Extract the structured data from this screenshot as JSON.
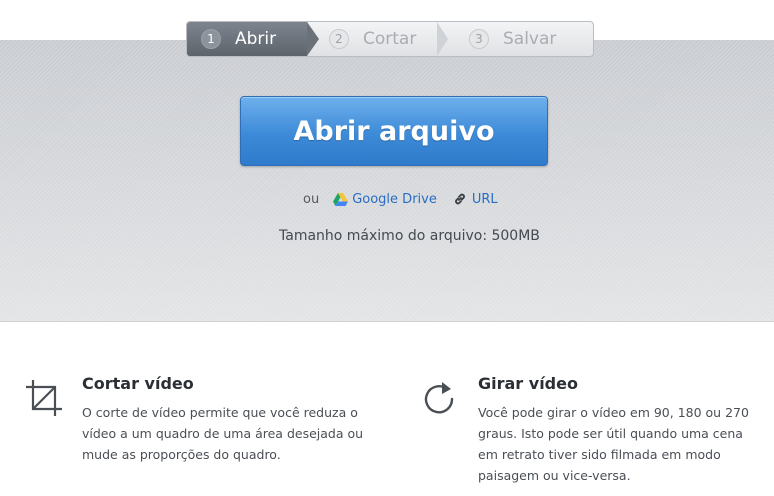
{
  "steps": [
    {
      "number": "1",
      "label": "Abrir",
      "active": true
    },
    {
      "number": "2",
      "label": "Cortar",
      "active": false
    },
    {
      "number": "3",
      "label": "Salvar",
      "active": false
    }
  ],
  "upload": {
    "button_label": "Abrir arquivo",
    "or_text": "ou",
    "google_drive_label": "Google Drive",
    "url_label": "URL",
    "max_size_text": "Tamanho máximo do arquivo: 500MB"
  },
  "features": {
    "crop": {
      "icon": "crop-icon",
      "title": "Cortar vídeo",
      "description": "O corte de vídeo permite que você reduza o vídeo a um quadro de uma área desejada ou mude as proporções do quadro."
    },
    "rotate": {
      "icon": "rotate-icon",
      "title": "Girar vídeo",
      "description": "Você pode girar o vídeo em 90, 180 ou 270 graus. Isto pode ser útil quando uma cena em retrato tiver sido filmada em modo paisagem ou vice-versa."
    }
  },
  "colors": {
    "button_blue": "#3d8ad8",
    "link_blue": "#2a6cc4",
    "active_step": "#6a7179"
  }
}
